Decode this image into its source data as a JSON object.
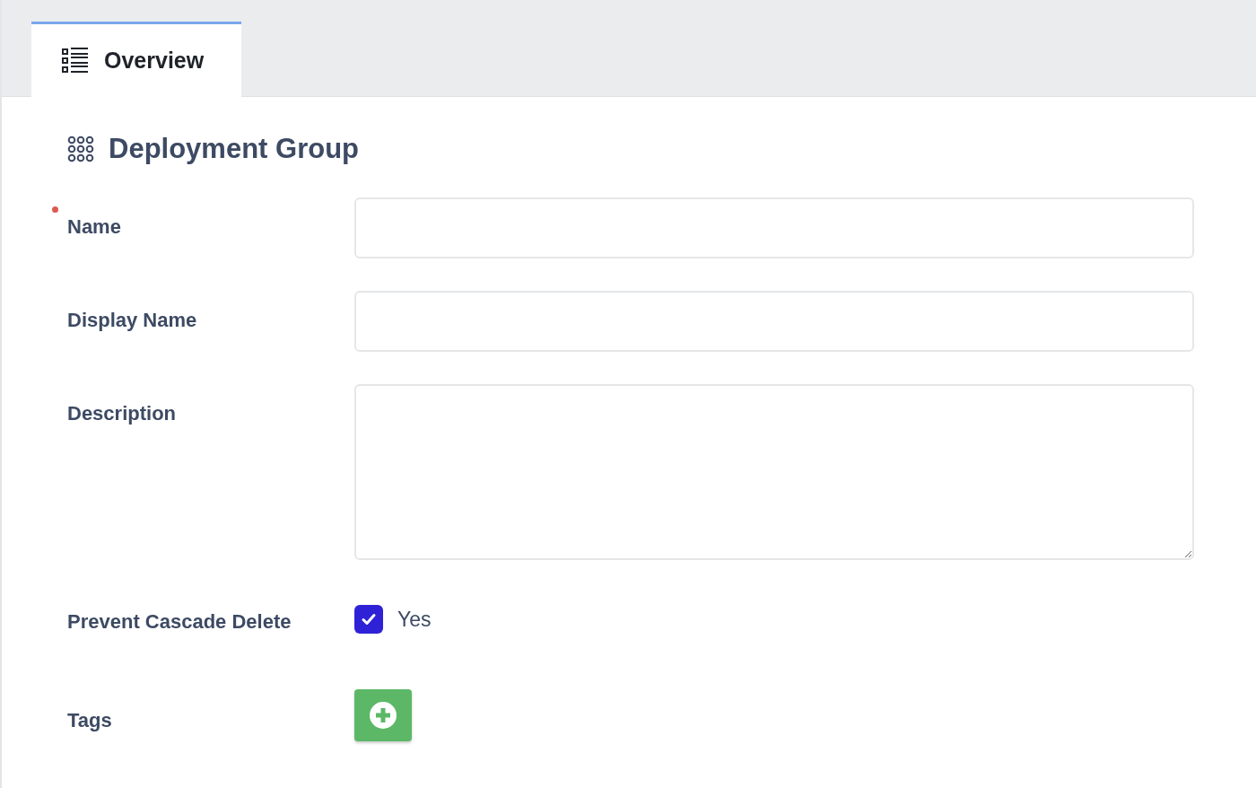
{
  "tabs": [
    {
      "label": "Overview",
      "selected": true
    }
  ],
  "section": {
    "title": "Deployment Group"
  },
  "fields": [
    {
      "kind": "text",
      "label": "Name",
      "required": true
    },
    {
      "kind": "text",
      "label": "Display Name",
      "required": false
    },
    {
      "kind": "textarea",
      "label": "Description",
      "required": false
    },
    {
      "kind": "checkbox",
      "label": "Prevent Cascade Delete",
      "required": false,
      "checked": true,
      "option": "Yes"
    },
    {
      "kind": "tags",
      "label": "Tags",
      "required": false
    }
  ]
}
